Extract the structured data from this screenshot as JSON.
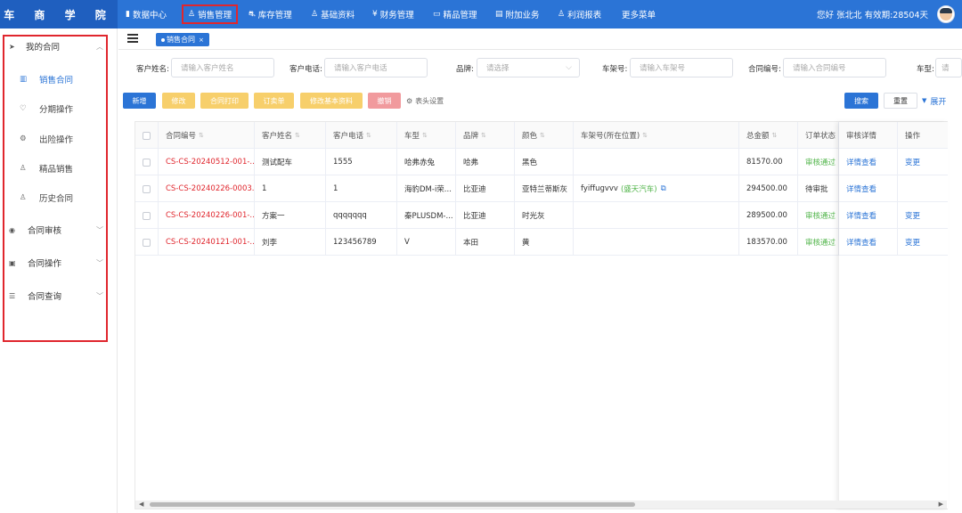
{
  "brand": "车 商 学 院",
  "nav": [
    {
      "label": "数据中心",
      "icon": "bar-chart-icon"
    },
    {
      "label": "销售管理",
      "icon": "user-icon",
      "active": true
    },
    {
      "label": "库存管理",
      "icon": "car-icon"
    },
    {
      "label": "基础资料",
      "icon": "user-icon"
    },
    {
      "label": "财务管理",
      "icon": "yen-icon"
    },
    {
      "label": "精品管理",
      "icon": "monitor-icon"
    },
    {
      "label": "附加业务",
      "icon": "document-icon"
    },
    {
      "label": "利润报表",
      "icon": "user-icon"
    },
    {
      "label": "更多菜单",
      "icon": ""
    }
  ],
  "user_greeting": "您好 张北北  有效期:28504天",
  "sidebar": {
    "groups": [
      {
        "label": "我的合同",
        "icon": "send-icon"
      },
      {
        "label": "合同审核",
        "icon": "eye-icon"
      },
      {
        "label": "合同操作",
        "icon": "clipboard-icon"
      },
      {
        "label": "合同查询",
        "icon": "list-icon"
      }
    ],
    "items": [
      {
        "label": "销售合同",
        "icon": "book-icon",
        "active": true
      },
      {
        "label": "分期操作",
        "icon": "shield-icon"
      },
      {
        "label": "出险操作",
        "icon": "gear-icon"
      },
      {
        "label": "精品销售",
        "icon": "user-icon"
      },
      {
        "label": "历史合同",
        "icon": "user-icon"
      }
    ]
  },
  "tab": {
    "label": "销售合同",
    "close": "×"
  },
  "filters": {
    "customer_name": {
      "label": "客户姓名:",
      "placeholder": "请输入客户姓名"
    },
    "customer_phone": {
      "label": "客户电话:",
      "placeholder": "请输入客户电话"
    },
    "brand": {
      "label": "品牌:",
      "placeholder": "请选择"
    },
    "vin": {
      "label": "车架号:",
      "placeholder": "请输入车架号"
    },
    "contract_no": {
      "label": "合同编号:",
      "placeholder": "请输入合同编号"
    },
    "model": {
      "label": "车型:",
      "placeholder": "请"
    }
  },
  "actions": {
    "add": "新增",
    "edit": "修改",
    "print": "合同打印",
    "order": "订卖单",
    "modify_basic": "修改基本资料",
    "void": "撤销",
    "column_settings": "表头设置",
    "search": "搜索",
    "reset": "重置",
    "expand": "展开"
  },
  "table": {
    "headers": [
      "合同编号",
      "客户姓名",
      "客户电话",
      "车型",
      "品牌",
      "颜色",
      "车架号(所在位置)",
      "总金额",
      "订单状态",
      "审核详情",
      "操作"
    ],
    "rows": [
      {
        "contract_no": "CS-CS-20240512-001-...",
        "name": "测试配车",
        "phone": "1555",
        "model": "哈弗赤兔",
        "brand": "哈弗",
        "color": "黑色",
        "vin": "",
        "vin_loc": "",
        "total": "81570.00",
        "status": "审核通过",
        "review": "详情查看",
        "op": "变更"
      },
      {
        "contract_no": "CS-CS-20240226-0003...",
        "name": "1",
        "phone": "1",
        "model": "海豹DM-i荣...",
        "brand": "比亚迪",
        "color": "亚特兰蒂斯灰",
        "vin": "fyiffugvvv",
        "vin_loc": "(盛天汽车)",
        "total": "294500.00",
        "status": "待审批",
        "review": "详情查看",
        "op": ""
      },
      {
        "contract_no": "CS-CS-20240226-001-...",
        "name": "方案一",
        "phone": "qqqqqqq",
        "model": "秦PLUSDM-...",
        "brand": "比亚迪",
        "color": "时光灰",
        "vin": "",
        "vin_loc": "",
        "total": "289500.00",
        "status": "审核通过",
        "review": "详情查看",
        "op": "变更"
      },
      {
        "contract_no": "CS-CS-20240121-001-...",
        "name": "刘李",
        "phone": "123456789",
        "model": "V",
        "brand": "本田",
        "color": "黄",
        "vin": "",
        "vin_loc": "",
        "total": "183570.00",
        "status": "审核通过",
        "review": "详情查看",
        "op": "变更"
      }
    ]
  },
  "colors": {
    "primary": "#2b74d6",
    "highlight": "#e0262d",
    "success": "#52b54b",
    "warning": "#f7cf6b"
  }
}
